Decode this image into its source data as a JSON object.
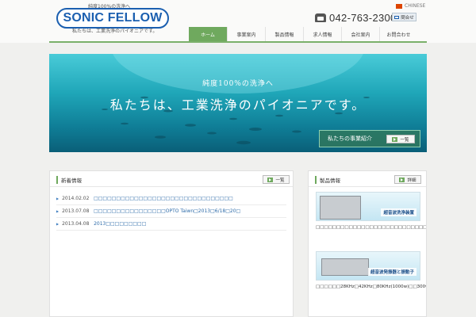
{
  "header": {
    "tagline": "純度100%の洗浄へ",
    "logo_text": "SONIC FELLOW",
    "subtitle": "私たちは、工業洗浄のパイオニアです。",
    "phone": "042-763-2300",
    "language_label": "CHINESE",
    "contact_label": "問合せ"
  },
  "nav": {
    "items": [
      {
        "label": "ホーム",
        "active": true
      },
      {
        "label": "事業案内",
        "active": false
      },
      {
        "label": "製品情報",
        "active": false
      },
      {
        "label": "求人情報",
        "active": false
      },
      {
        "label": "会社案内",
        "active": false
      },
      {
        "label": "お問合わせ",
        "active": false
      }
    ]
  },
  "hero": {
    "subtitle": "純度100%の洗浄へ",
    "title": "私たちは、工業洗浄のパイオニアです。",
    "button_label": "私たちの事業紹介",
    "more_label": "一覧"
  },
  "news": {
    "title": "新着情報",
    "more_label": "一覧",
    "items": [
      {
        "date": "2014.02.02",
        "text": "□□□□□□□□□□□□□□□□□□□□□□□□□□□□□□□"
      },
      {
        "date": "2013.07.08",
        "text": "□□□□□□□□□□□□□□□□OPTO Taiwn□2013□6/18□20□"
      },
      {
        "date": "2013.04.08",
        "text": "2013□□□□□□□□□"
      }
    ]
  },
  "products": {
    "title": "製品情報",
    "more_label": "詳細",
    "items": [
      {
        "label": "超音波洗浄装置",
        "desc": "□□□□□□□□□□□□□□□□□□□□□□□□□□□□□□□□□□□□□□□□□□□□□□□□□□□□□□□□□□□□□□□□□□□□□□□□□□"
      },
      {
        "label": "超音波発振器と振動子",
        "desc": "□□□□□□28KHz□42KHz□80KHz(1000w)□□300w□600w□1200w□1800w□□□□□□□□□□□□□□□□□□□"
      }
    ]
  },
  "colors": {
    "brand_blue": "#1b5fb0",
    "nav_green": "#6fa95e",
    "sea": "#1fa6b8"
  }
}
